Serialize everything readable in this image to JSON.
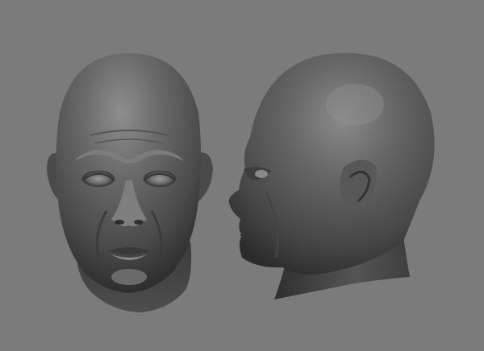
{
  "scene": {
    "background_color": "#7b7b7b",
    "material_color": "#5a5a5a",
    "objects": [
      {
        "id": "front",
        "icon": "head-front-view"
      },
      {
        "id": "side",
        "icon": "head-profile-view"
      }
    ]
  }
}
